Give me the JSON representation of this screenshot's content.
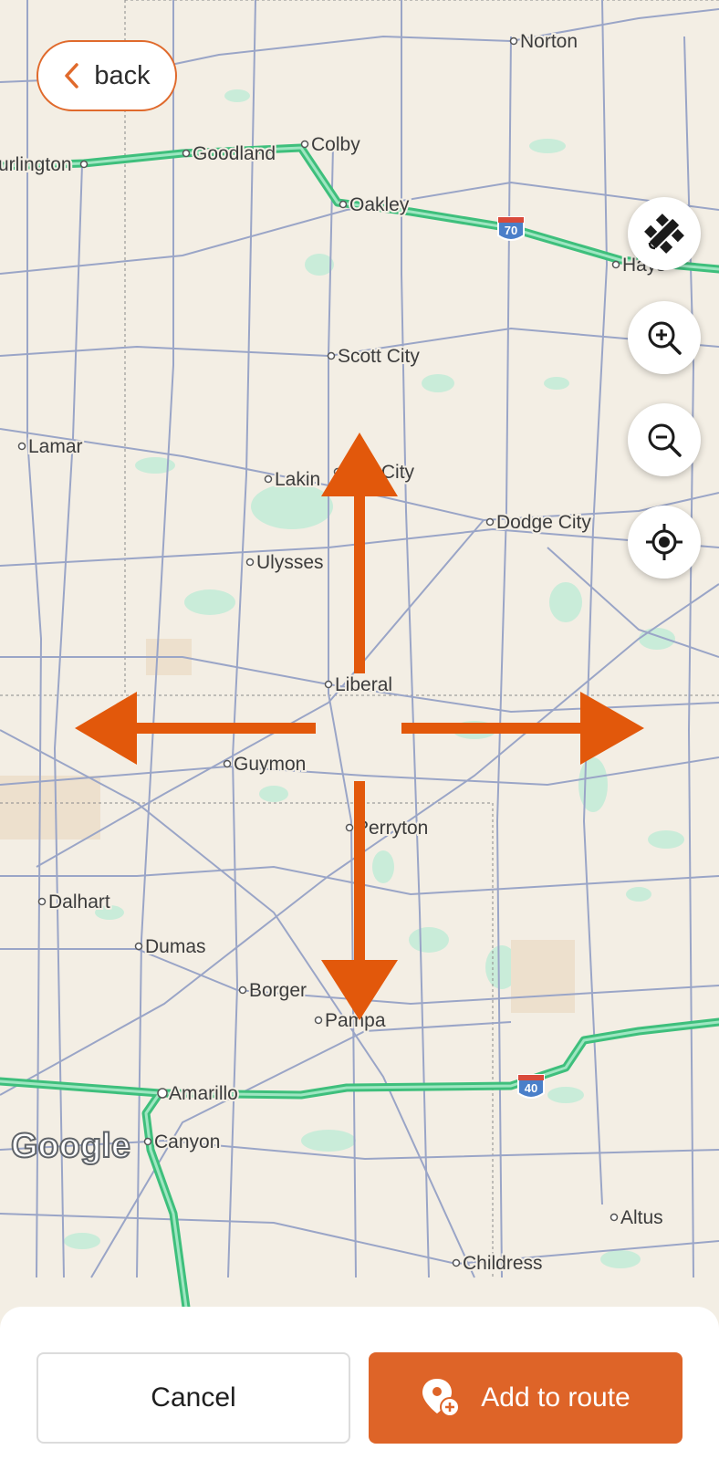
{
  "header": {
    "back_label": "back"
  },
  "map": {
    "attribution": "Google",
    "cities": [
      {
        "name": "Norton"
      },
      {
        "name": "urlington"
      },
      {
        "name": "Goodland"
      },
      {
        "name": "Colby"
      },
      {
        "name": "Oakley"
      },
      {
        "name": "Hays"
      },
      {
        "name": "Scott City"
      },
      {
        "name": "Lamar"
      },
      {
        "name": "Lakin"
      },
      {
        "name": "den City"
      },
      {
        "name": "Dodge City"
      },
      {
        "name": "Ulysses"
      },
      {
        "name": "Liberal"
      },
      {
        "name": "Guymon"
      },
      {
        "name": "Perryton"
      },
      {
        "name": "Dalhart"
      },
      {
        "name": "Dumas"
      },
      {
        "name": "Borger"
      },
      {
        "name": "Pampa"
      },
      {
        "name": "Amarillo"
      },
      {
        "name": "Canyon"
      },
      {
        "name": "Altus"
      },
      {
        "name": "Childress"
      }
    ],
    "shields": [
      {
        "label": "70"
      },
      {
        "label": "40"
      }
    ],
    "colors": {
      "land": "#f3eee4",
      "highway": "#3ebf7c",
      "road": "#9aa5c7",
      "park": "#c9ecd9",
      "arrows": "#e2580b"
    }
  },
  "controls": {
    "satellite_icon": "satellite-icon",
    "zoom_in_icon": "zoom-in-icon",
    "zoom_out_icon": "zoom-out-icon",
    "locate_icon": "my-location-icon"
  },
  "footer": {
    "cancel_label": "Cancel",
    "add_label": "Add to route",
    "accent": "#de6428"
  }
}
